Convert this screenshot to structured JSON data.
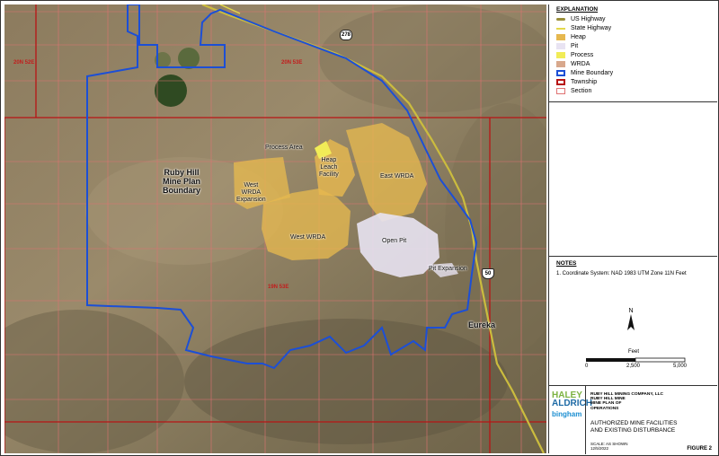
{
  "legend": {
    "title": "EXPLANATION",
    "items": [
      {
        "label": "US Highway",
        "color": "#9a8f3a",
        "kind": "line"
      },
      {
        "label": "State Highway",
        "color": "#e3d84a",
        "kind": "line"
      },
      {
        "label": "Heap",
        "color": "#e6b84f",
        "kind": "fill"
      },
      {
        "label": "Pit",
        "color": "#e8e3f2",
        "kind": "fill"
      },
      {
        "label": "Process",
        "color": "#f1ec57",
        "kind": "fill"
      },
      {
        "label": "WRDA",
        "color": "#d8a88c",
        "kind": "fill"
      },
      {
        "label": "Mine Boundary",
        "color": "#1c4fd6",
        "kind": "box"
      },
      {
        "label": "Township",
        "color": "#b81414",
        "kind": "box"
      },
      {
        "label": "Section",
        "color": "#e07272",
        "kind": "box"
      }
    ]
  },
  "map": {
    "labels": {
      "process_area": "Process Area",
      "heap_leach": "Heap\nLeach\nFacility",
      "east_wrda": "East WRDA",
      "west_wrda_exp": "West\nWRDA\nExpansion",
      "west_wrda": "West WRDA",
      "open_pit": "Open Pit",
      "pit_expansion": "Pit Expansion",
      "mine_plan": "Ruby Hill\nMine Plan\nBoundary",
      "eureka": "Eureka"
    },
    "townships": [
      "20N 52E",
      "20N 53E",
      "19N 53E"
    ],
    "highways": {
      "state": "278",
      "us": "50"
    }
  },
  "notes": {
    "title": "NOTES",
    "items": [
      "1. Coordinate System: NAD 1983 UTM Zone 11N Feet"
    ]
  },
  "north": "N",
  "scale": {
    "title": "Feet",
    "ticks": [
      "0",
      "2,500",
      "5,000"
    ]
  },
  "title_block": {
    "company": [
      "RUBY HILL MINING COMPANY, LLC",
      "RUBY HILL MINE",
      "MINE PLAN OF",
      "OPERATIONS"
    ],
    "figure_title": [
      "AUTHORIZED MINE FACILITIES",
      "AND EXISTING DISTURBANCE"
    ],
    "scale_text": "SCALE: AS SHOWN",
    "date": "12/5/2022",
    "figure": "FIGURE 2",
    "logo_haley_1": "HALEY",
    "logo_haley_2": "ALDRICH",
    "logo_bingham": "bingham"
  }
}
